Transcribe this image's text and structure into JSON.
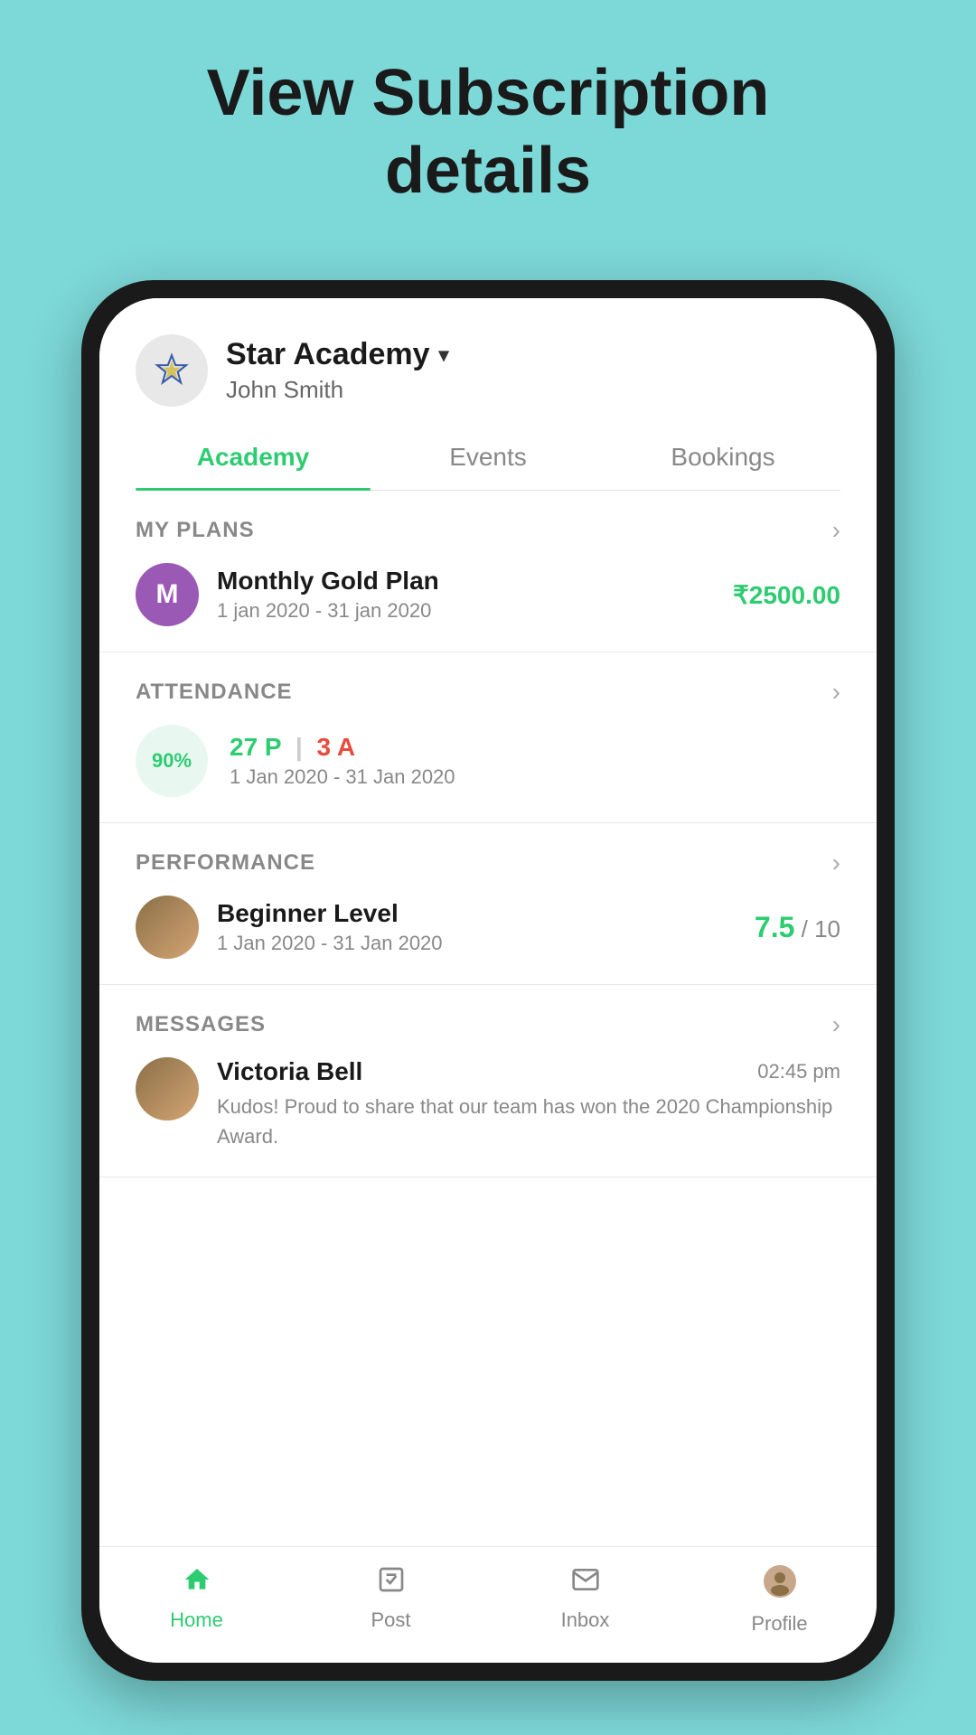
{
  "page": {
    "background_title_line1": "View Subscription",
    "background_title_line2": "details"
  },
  "header": {
    "academy_name": "Star Academy",
    "dropdown_symbol": "▾",
    "user_name": "John Smith"
  },
  "tabs": [
    {
      "label": "Academy",
      "active": true
    },
    {
      "label": "Events",
      "active": false
    },
    {
      "label": "Bookings",
      "active": false
    }
  ],
  "sections": {
    "my_plans": {
      "title": "MY PLANS",
      "plan": {
        "icon_letter": "M",
        "name": "Monthly Gold Plan",
        "dates": "1 jan 2020 - 31 jan 2020",
        "price": "₹2500.00"
      }
    },
    "attendance": {
      "title": "ATTENDANCE",
      "percent": "90%",
      "present_label": "27 P",
      "absent_label": "3 A",
      "dates": "1 Jan 2020 - 31 Jan 2020"
    },
    "performance": {
      "title": "PERFORMANCE",
      "level": "Beginner Level",
      "dates": "1 Jan 2020 - 31 Jan 2020",
      "score_value": "7.5",
      "score_max": "/ 10"
    },
    "messages": {
      "title": "MESSAGES",
      "sender": "Victoria Bell",
      "time": "02:45 pm",
      "text": "Kudos! Proud to share that our team has won the 2020 Championship Award."
    }
  },
  "bottom_nav": [
    {
      "icon": "home",
      "label": "Home",
      "active": true
    },
    {
      "icon": "post",
      "label": "Post",
      "active": false
    },
    {
      "icon": "inbox",
      "label": "Inbox",
      "active": false
    },
    {
      "icon": "profile",
      "label": "Profile",
      "active": false
    }
  ]
}
